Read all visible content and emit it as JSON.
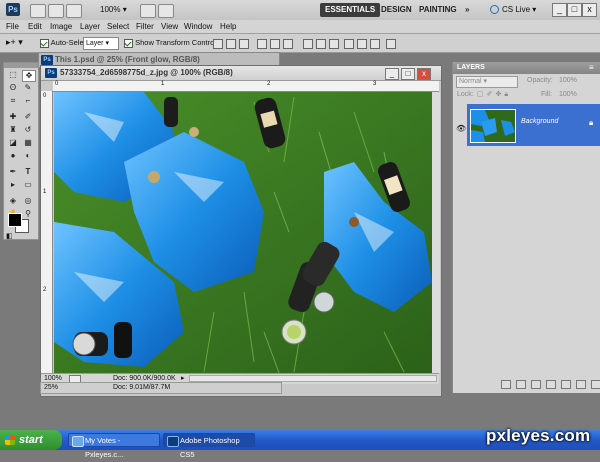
{
  "app_bar": {
    "logo": "Ps",
    "zoom": "100%",
    "workspaces": [
      "ESSENTIALS",
      "DESIGN",
      "PAINTING"
    ],
    "more": "»",
    "cs_live": "CS Live",
    "window_controls": [
      "_",
      "□",
      "x"
    ]
  },
  "menus": [
    "File",
    "Edit",
    "Image",
    "Layer",
    "Select",
    "Filter",
    "View",
    "Window",
    "Help"
  ],
  "options_bar": {
    "auto_select_label": "Auto-Select:",
    "auto_select_value": "Layer",
    "show_transform_label": "Show Transform Controls"
  },
  "background_doc": {
    "title": "This 1.psd @ 25% (Front glow, RGB/8)"
  },
  "document": {
    "icon": "Ps",
    "title": "57333754_2d6598775d_z.jpg @ 100% (RGB/8)",
    "zoom": "100%",
    "doc_info": "Doc: 900.0K/900.0K",
    "ruler_marks": [
      "0",
      "1",
      "2",
      "3"
    ]
  },
  "outer_status": {
    "zoom": "25%",
    "doc_info": "Doc: 9.01M/87.7M"
  },
  "layers_panel": {
    "title": "LAYERS",
    "blend_mode": "Normal",
    "opacity_label": "Opacity:",
    "opacity_value": "100%",
    "lock_label": "Lock:",
    "fill_label": "Fill:",
    "fill_value": "100%",
    "layer_name": "Background"
  },
  "taskbar": {
    "start": "start",
    "tasks": [
      "My Votes - Pxleyes.c...",
      "Adobe Photoshop CS5"
    ]
  },
  "watermark": "pxleyes.com"
}
